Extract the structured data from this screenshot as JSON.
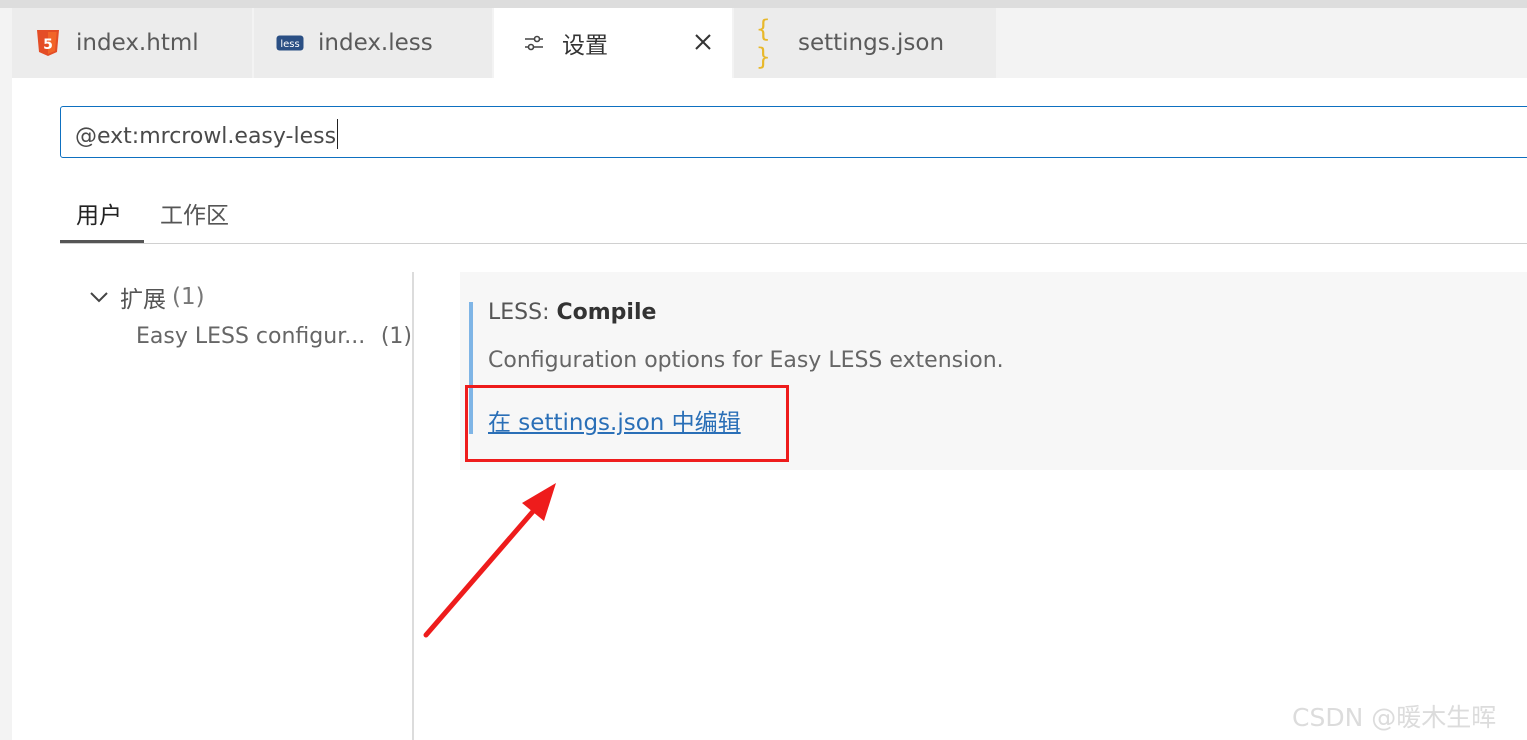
{
  "tabs": [
    {
      "label": "index.html",
      "icon": "html5-icon"
    },
    {
      "label": "index.less",
      "icon": "less-file-icon"
    },
    {
      "label": "设置",
      "icon": "settings-sliders-icon",
      "active": true
    },
    {
      "label": "settings.json",
      "icon": "json-braces-icon"
    }
  ],
  "search": {
    "value": "@ext:mrcrowl.easy-less"
  },
  "scope_tabs": [
    {
      "label": "用户",
      "active": true
    },
    {
      "label": "工作区"
    }
  ],
  "toc": {
    "group_label": "扩展",
    "group_count": "(1)",
    "item_label": "Easy LESS configur...",
    "item_count": "(1)"
  },
  "setting": {
    "title_prefix": "LESS: ",
    "title_name": "Compile",
    "description": "Configuration options for Easy LESS extension.",
    "link_label": "在 settings.json 中编辑"
  },
  "colors": {
    "accent": "#0e70c0",
    "highlight": "#ee1c1c",
    "link": "#2a6fb7"
  },
  "watermark": "CSDN @暖木生晖"
}
